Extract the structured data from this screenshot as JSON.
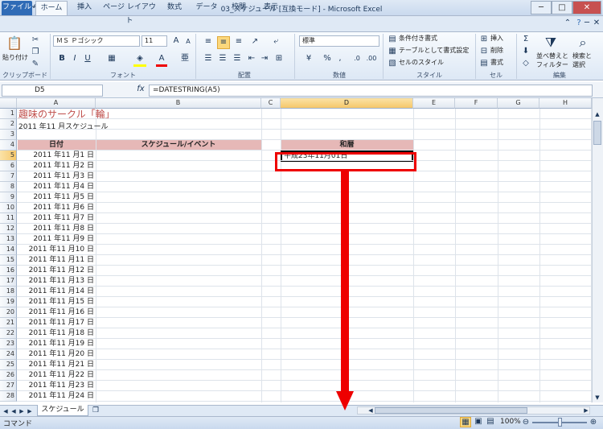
{
  "window": {
    "title": "03_スケジュール [互換モード] - Microsoft Excel",
    "excel_logo": "X",
    "min": "─",
    "max": "□",
    "close": "✕"
  },
  "tabs": [
    "ファイル",
    "ホーム",
    "挿入",
    "ページ レイアウト",
    "数式",
    "データ",
    "校閲",
    "表示"
  ],
  "ribbon": {
    "paste_label": "貼り付け",
    "font_name": "ＭＳ Ｐゴシック",
    "font_size": "11",
    "number_format": "標準",
    "cond_format": "条件付き書式",
    "table_format": "テーブルとして書式設定",
    "cell_style": "セルのスタイル",
    "insert": "挿入",
    "delete": "削除",
    "format": "書式",
    "sort_filter_1": "並べ替えと",
    "sort_filter_2": "フィルター",
    "find_select_1": "検索と",
    "find_select_2": "選択",
    "groups": {
      "clipboard": "クリップボード",
      "font": "フォント",
      "alignment": "配置",
      "number": "数値",
      "style": "スタイル",
      "cells": "セル",
      "editing": "編集"
    }
  },
  "formula_bar": {
    "namebox": "D5",
    "fx": "fx",
    "formula": "=DATESTRING(A5)"
  },
  "columns": [
    "A",
    "B",
    "C",
    "D",
    "E",
    "F",
    "G",
    "H"
  ],
  "rows": [
    "1",
    "2",
    "3",
    "4",
    "5",
    "6",
    "7",
    "8",
    "9",
    "10",
    "11",
    "12",
    "13",
    "14",
    "15",
    "16",
    "17",
    "18",
    "19",
    "20",
    "21",
    "22",
    "23",
    "24",
    "25",
    "26",
    "27",
    "28"
  ],
  "cells": {
    "a1": "趣味のサークル「輪」",
    "a2": "2011 年11 月スケジュール",
    "a4": "日付",
    "b4": "スケジュール/イベント",
    "d4": "和暦",
    "d5": "平成23年11月01日"
  },
  "dates": [
    "2011 年11 月1 日",
    "2011 年11 月2 日",
    "2011 年11 月3 日",
    "2011 年11 月4 日",
    "2011 年11 月5 日",
    "2011 年11 月6 日",
    "2011 年11 月7 日",
    "2011 年11 月8 日",
    "2011 年11 月9 日",
    "2011 年11 月10 日",
    "2011 年11 月11 日",
    "2011 年11 月12 日",
    "2011 年11 月13 日",
    "2011 年11 月14 日",
    "2011 年11 月15 日",
    "2011 年11 月16 日",
    "2011 年11 月17 日",
    "2011 年11 月18 日",
    "2011 年11 月19 日",
    "2011 年11 月20 日",
    "2011 年11 月21 日",
    "2011 年11 月22 日",
    "2011 年11 月23 日",
    "2011 年11 月24 日"
  ],
  "sheet_tab": "スケジュール",
  "status": {
    "mode": "コマンド",
    "zoom": "100%"
  },
  "colors": {
    "header_fill": "#e6b8b7",
    "title_red": "#c0504d",
    "annotation": "#e00000"
  }
}
